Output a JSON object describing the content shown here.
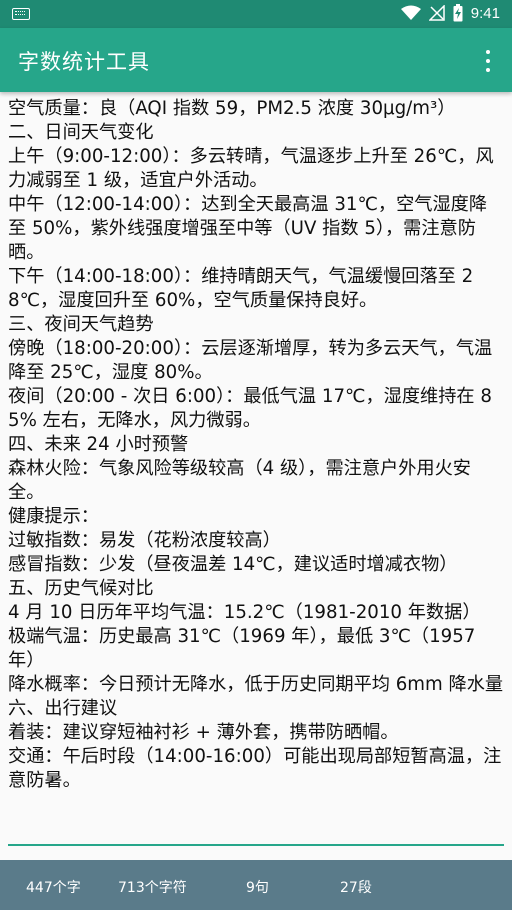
{
  "status": {
    "time": "9:41"
  },
  "app": {
    "title": "字数统计工具"
  },
  "editor_text": "空气质量：良（AQI 指数 59，PM2.5 浓度 30μg/m³）\n二、日间天气变化\n上午（9:00-12:00）：多云转晴，气温逐步上升至 26℃，风力减弱至 1 级，适宜户外活动。\n中午（12:00-14:00）：达到全天最高温 31℃，空气湿度降至 50%，紫外线强度增强至中等（UV 指数 5），需注意防晒。\n下午（14:00-18:00）：维持晴朗天气，气温缓慢回落至 28℃，湿度回升至 60%，空气质量保持良好。\n三、夜间天气趋势\n傍晚（18:00-20:00）：云层逐渐增厚，转为多云天气，气温降至 25℃，湿度 80%。\n夜间（20:00 - 次日 6:00）：最低气温 17℃，湿度维持在 85% 左右，无降水，风力微弱。\n四、未来 24 小时预警\n森林火险：气象风险等级较高（4 级），需注意户外用火安全。\n健康提示：\n过敏指数：易发（花粉浓度较高）\n感冒指数：少发（昼夜温差 14℃，建议适时增减衣物）\n五、历史气候对比\n4 月 10 日历年平均气温：15.2℃（1981-2010 年数据）\n极端气温：历史最高 31℃（1969 年），最低 3℃（1957 年）\n降水概率：今日预计无降水，低于历史同期平均 6mm 降水量\n六、出行建议\n着装：建议穿短袖衬衫 + 薄外套，携带防晒帽。\n交通：午后时段（14:00-16:00）可能出现局部短暂高温，注意防暑。",
  "stats": {
    "chars": "447个字",
    "symbols": "713个字符",
    "sentences": "9句",
    "paragraphs": "27段"
  }
}
